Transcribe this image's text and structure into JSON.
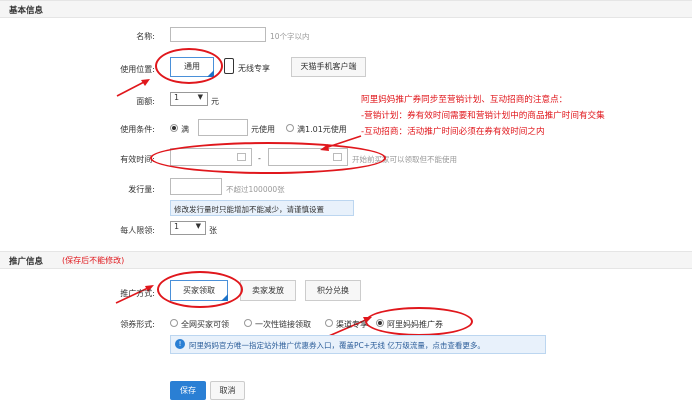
{
  "basic": {
    "section_title": "基本信息",
    "name_label": "名称:",
    "name_hint": "10个字以内",
    "position_label": "使用位置:",
    "position_options": [
      "通用",
      "无线专享",
      "天猫手机客户端"
    ],
    "face_label": "面额:",
    "face_value": "1",
    "face_unit": "元",
    "condition_label": "使用条件:",
    "condition_full": "满",
    "condition_unit": "元使用",
    "condition_alt": "满1.01元使用",
    "valid_label": "有效时间:",
    "valid_sep": "-",
    "valid_hint": "开始前买家可以领取但不能使用",
    "issue_label": "发行量:",
    "issue_hint": "不超过100000张",
    "issue_tip": "修改发行量时只能增加不能减少，请谨慎设置",
    "limit_label": "每人限领:",
    "limit_value": "1",
    "limit_unit": "张"
  },
  "notes": {
    "line1": "阿里妈妈推广券同步至营销计划、互动招商的注意点：",
    "line2": "-营销计划：券有效时间需要和营销计划中的商品推广时间有交集",
    "line3": "-互动招商：活动推广时间必须在券有效时间之内"
  },
  "promo": {
    "section_title": "推广信息",
    "section_note": "(保存后不能修改)",
    "method_label": "推广方式:",
    "method_options": [
      "买家领取",
      "卖家发放",
      "积分兑换"
    ],
    "form_label": "领券形式:",
    "form_options": [
      "全网买家可领",
      "一次性链接领取",
      "渠道专享",
      "阿里妈妈推广券"
    ],
    "info_text": "阿里妈妈官方唯一指定站外推广优惠券入口，覆盖PC+无线 亿万级流量，点击查看更多。"
  },
  "actions": {
    "save": "保存",
    "cancel": "取消"
  },
  "colors": {
    "annotation": "#e0171c",
    "accent": "#1e73c8",
    "save_button": "#2a7fd4"
  }
}
